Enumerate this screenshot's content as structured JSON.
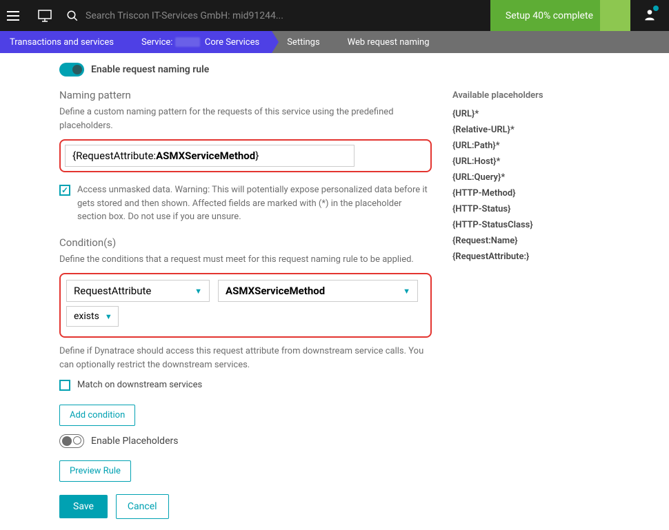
{
  "topbar": {
    "search_placeholder": "Search Triscon IT-Services GmbH: mid91244...",
    "setup_label": "Setup 40% complete"
  },
  "breadcrumb": {
    "items": [
      "Transactions and services",
      "Service:        Core Services",
      "Settings",
      "Web request naming"
    ]
  },
  "main": {
    "enable_rule_label": "Enable request naming rule",
    "naming_pattern_title": "Naming pattern",
    "naming_pattern_desc": "Define a custom naming pattern for the requests of this service using the predefined placeholders.",
    "pattern_value_prefix": "{RequestAttribute:",
    "pattern_value_bold": "ASMXServiceMethod",
    "pattern_value_suffix": "}",
    "unmasked_label": "Access unmasked data. Warning: This will potentially expose personalized data before it gets stored and then shown. Affected fields are marked with (*) in the placeholder section box. Do not use if you are unsure.",
    "conditions_title": "Condition(s)",
    "conditions_desc": "Define the conditions that a request must meet for this request naming rule to be applied.",
    "cond_select1": "RequestAttribute",
    "cond_select2": "ASMXServiceMethod",
    "cond_select3": "exists",
    "downstream_desc": "Define if Dynatrace should access this request attribute from downstream service calls. You can optionally restrict the downstream services.",
    "match_downstream_label": "Match on downstream services",
    "add_condition_label": "Add condition",
    "enable_placeholders_label": "Enable Placeholders",
    "preview_label": "Preview Rule",
    "save_label": "Save",
    "cancel_label": "Cancel"
  },
  "sidebar": {
    "title": "Available placeholders",
    "items": [
      "{URL}*",
      "{Relative-URL}*",
      "{URL:Path}*",
      "{URL:Host}*",
      "{URL:Query}*",
      "{HTTP-Method}",
      "{HTTP-Status}",
      "{HTTP-StatusClass}",
      "{Request:Name}",
      "{RequestAttribute:}"
    ]
  }
}
